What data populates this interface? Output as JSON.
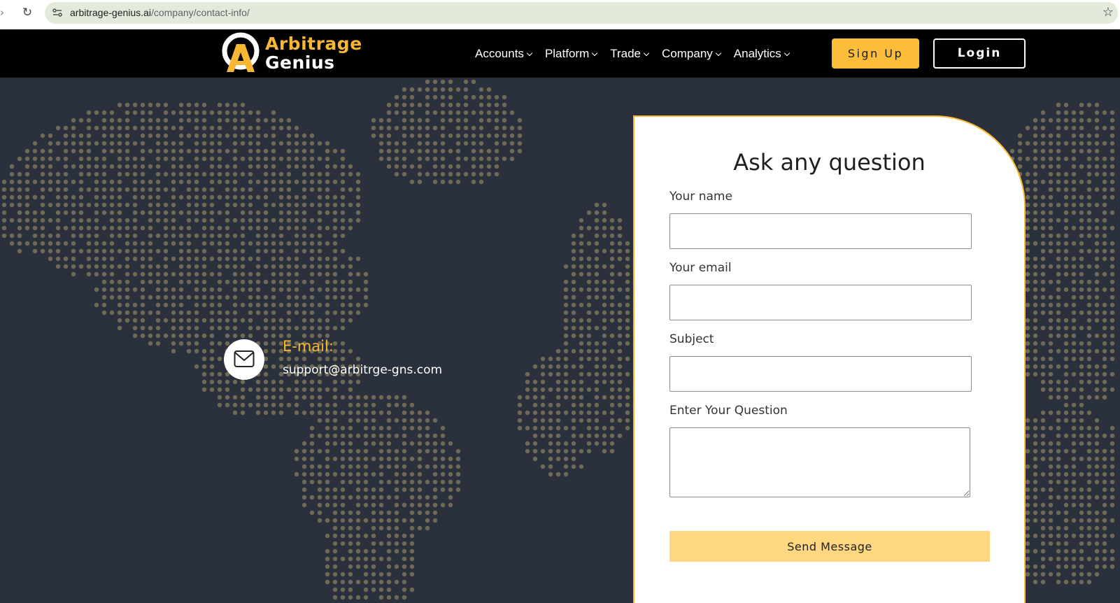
{
  "browser": {
    "url_host": "arbitrage-genius.ai",
    "url_path": "/company/contact-info/"
  },
  "header": {
    "logo": {
      "line1": "Arbitrage",
      "line2": "Genius"
    },
    "nav": [
      {
        "label": "Accounts"
      },
      {
        "label": "Platform"
      },
      {
        "label": "Trade"
      },
      {
        "label": "Company"
      },
      {
        "label": "Analytics"
      }
    ],
    "signup_label": "Sign Up",
    "login_label": "Login"
  },
  "contact": {
    "email_label": "E-mail:",
    "email_value": "support@arbitrge-gns.com"
  },
  "form": {
    "title": "Ask any question",
    "name_label": "Your name",
    "email_label": "Your email",
    "subject_label": "Subject",
    "question_label": "Enter Your Question",
    "send_label": "Send Message"
  },
  "colors": {
    "accent": "#f7b733",
    "signup_bg": "#fbbd3a",
    "send_bg": "#fed780",
    "page_bg": "#2b313c",
    "header_bg": "#000000",
    "map_dots": "#6e6a55"
  }
}
